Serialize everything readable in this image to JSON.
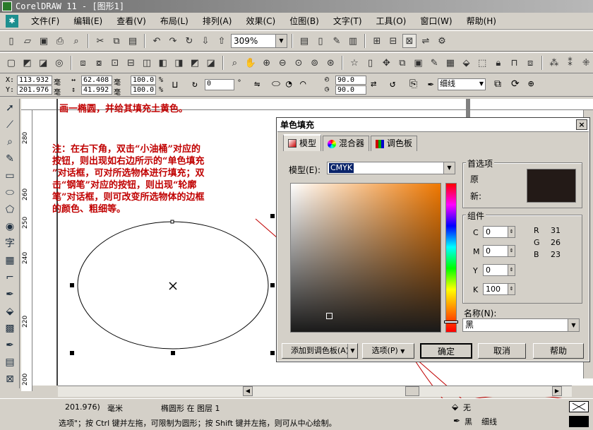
{
  "app": {
    "title": "CorelDRAW 11 - [图形1]"
  },
  "menu": [
    "文件(F)",
    "编辑(E)",
    "查看(V)",
    "布局(L)",
    "排列(A)",
    "效果(C)",
    "位图(B)",
    "文字(T)",
    "工具(O)",
    "窗口(W)",
    "帮助(H)"
  ],
  "toolbar": {
    "zoom": "309%"
  },
  "props": {
    "x": "113.932",
    "y": "201.976",
    "w": "62.408",
    "h": "41.992",
    "sx": "100.0",
    "sy": "100.0",
    "pct": "%",
    "rotation": "0",
    "deg": "°",
    "angle1": "90.0",
    "angle2": "90.0",
    "outline": "细线",
    "x_label": "X:",
    "y_label": "Y:",
    "unit_mm": "毫"
  },
  "ruler": {
    "vertical_ticks": [
      "280",
      "260",
      "250",
      "240",
      "220",
      "200"
    ]
  },
  "canvas": {
    "heading": "画一椭圆，并给其填充土黄色。",
    "note_lines": [
      "注：在右下角，双击“小油桶”对应的",
      "按钮，则出现如右边所示的“单色填充",
      "”对话框，可对所选物体进行填充；双",
      "击“钢笔”对应的按钮，则出现“轮廓",
      "笔”对话框，则可改变所选物体的边框",
      "的颜色、粗细等。"
    ]
  },
  "dialog": {
    "title": "单色填充",
    "close": "×",
    "tabs": [
      "模型",
      "混合器",
      "调色板"
    ],
    "model_label": "模型(E):",
    "model_value": "CMYK",
    "ref_legend": "首选项",
    "ref_original": "原",
    "ref_new": "新:",
    "swatch_color": "#231a17",
    "components_legend": "组件",
    "cmyk": [
      {
        "label": "C",
        "value": "0"
      },
      {
        "label": "M",
        "value": "0"
      },
      {
        "label": "Y",
        "value": "0"
      },
      {
        "label": "K",
        "value": "100"
      }
    ],
    "rgb": [
      {
        "label": "R",
        "value": "31"
      },
      {
        "label": "G",
        "value": "26"
      },
      {
        "label": "B",
        "value": "23"
      }
    ],
    "name_label": "名称(N):",
    "name_value": "黑",
    "add_palette": "添加到调色板(A)",
    "options": "选项(P)",
    "ok": "确定",
    "cancel": "取消",
    "help": "帮助"
  },
  "status": {
    "line1_coords": "201.976)",
    "line1_unit": "毫米",
    "line1_object": "椭圆形 在 图层 1",
    "line2_hint": "选项\"；按 Ctrl 键并左拖，可限制为圆形；按 Shift 键并左拖，则可从中心绘制。",
    "fill_label": "无",
    "outline_color": "黑",
    "outline_width": "细线"
  }
}
